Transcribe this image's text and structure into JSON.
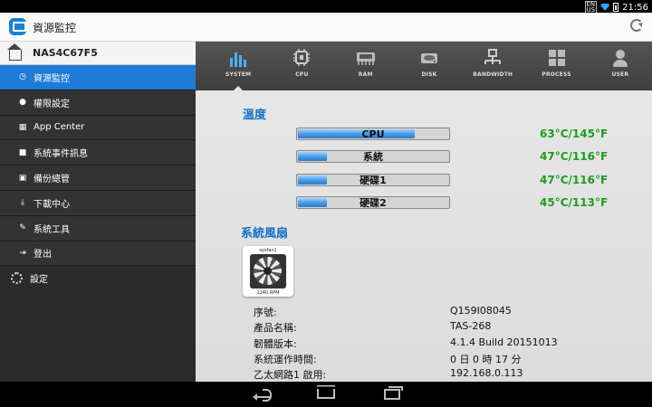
{
  "status_bar": {
    "language": "EN",
    "language_sub": "US",
    "time": "21:56"
  },
  "app": {
    "title": "資源監控"
  },
  "sidebar": {
    "nas_name": "NAS4C67F5",
    "items": [
      {
        "label": "資源監控",
        "icon": "clock-icon"
      },
      {
        "label": "權限設定",
        "icon": "user-icon"
      },
      {
        "label": "App Center",
        "icon": "grid-icon"
      },
      {
        "label": "系統事件訊息",
        "icon": "message-icon"
      },
      {
        "label": "備份總管",
        "icon": "backup-icon"
      },
      {
        "label": "下載中心",
        "icon": "download-icon"
      },
      {
        "label": "系統工具",
        "icon": "tools-icon"
      },
      {
        "label": "登出",
        "icon": "logout-icon"
      }
    ],
    "settings_label": "設定"
  },
  "tabs": [
    "SYSTEM",
    "CPU",
    "RAM",
    "DISK",
    "BANDWIDTH",
    "PROCESS",
    "USER"
  ],
  "temperature": {
    "title": "溫度",
    "rows": [
      {
        "label": "CPU",
        "value": "63°C/145°F",
        "level": 0.78
      },
      {
        "label": "系統",
        "value": "47°C/116°F",
        "level": 0.2
      },
      {
        "label": "硬碟1",
        "value": "47°C/116°F",
        "level": 0.2
      },
      {
        "label": "硬碟2",
        "value": "45°C/113°F",
        "level": 0.2
      }
    ]
  },
  "fan": {
    "title": "系統風扇",
    "name": "sysfan1",
    "rpm": "1140 RPM"
  },
  "info": [
    {
      "key": "序號:",
      "value": "Q159I08045"
    },
    {
      "key": "產品名稱:",
      "value": "TAS-268"
    },
    {
      "key": "韌體版本:",
      "value": "4.1.4 Build 20151013"
    },
    {
      "key": "系統運作時間:",
      "value": "0 日 0 時 17 分"
    },
    {
      "key": "乙太網路1 啟用:",
      "value": "192.168.0.113"
    }
  ],
  "colors": {
    "accent": "#1e7bd6",
    "temp_value": "#1d9e1d",
    "section_title": "#1270c6"
  }
}
